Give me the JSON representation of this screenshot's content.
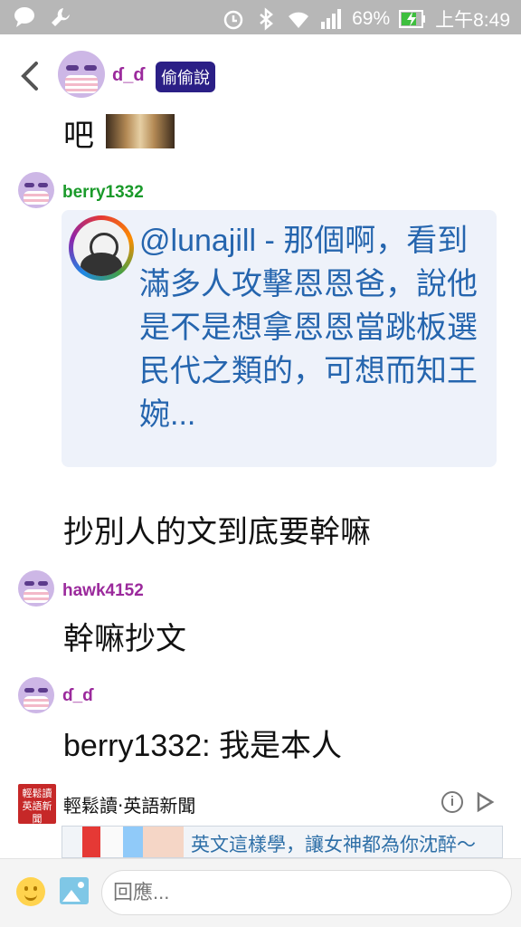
{
  "status_bar": {
    "battery": "69%",
    "time": "上午8:49",
    "icons": [
      "chat-icon",
      "wrench-icon",
      "alarm-icon",
      "bluetooth-icon",
      "wifi-icon",
      "signal-icon",
      "battery-charging-icon"
    ]
  },
  "header": {
    "name": "ɗ_ɗ",
    "badge": "偷偷說"
  },
  "messages": {
    "m0": {
      "text": "吧"
    },
    "m1": {
      "user": "berry1332",
      "user_color": "#1a9a2a",
      "quote": "@lunajill - 那個啊，看到滿多人攻擊恩恩爸，說他是不是想拿恩恩當跳板選民代之類的，可想而知王婉...",
      "reply": "抄別人的文到底要幹嘛"
    },
    "m2": {
      "user": "hawk4152",
      "user_color": "#9b2a9c",
      "text": "幹嘛抄文"
    },
    "m3": {
      "user": "ɗ_ɗ",
      "user_color": "#9b2a9c",
      "text": "berry1332: 我是本人"
    }
  },
  "ad": {
    "title": "輕鬆讀‧英語新聞",
    "logo_text": "輕鬆讀 英語新聞",
    "banner_text": "英文這樣學，讓女神都為你沈醉～"
  },
  "composer": {
    "placeholder": "回應..."
  },
  "colors": {
    "statusbar": "#b7b7b7",
    "quote_text": "#2565ae",
    "badge_bg": "#2b1f86",
    "purple_name": "#9b2a9c"
  }
}
